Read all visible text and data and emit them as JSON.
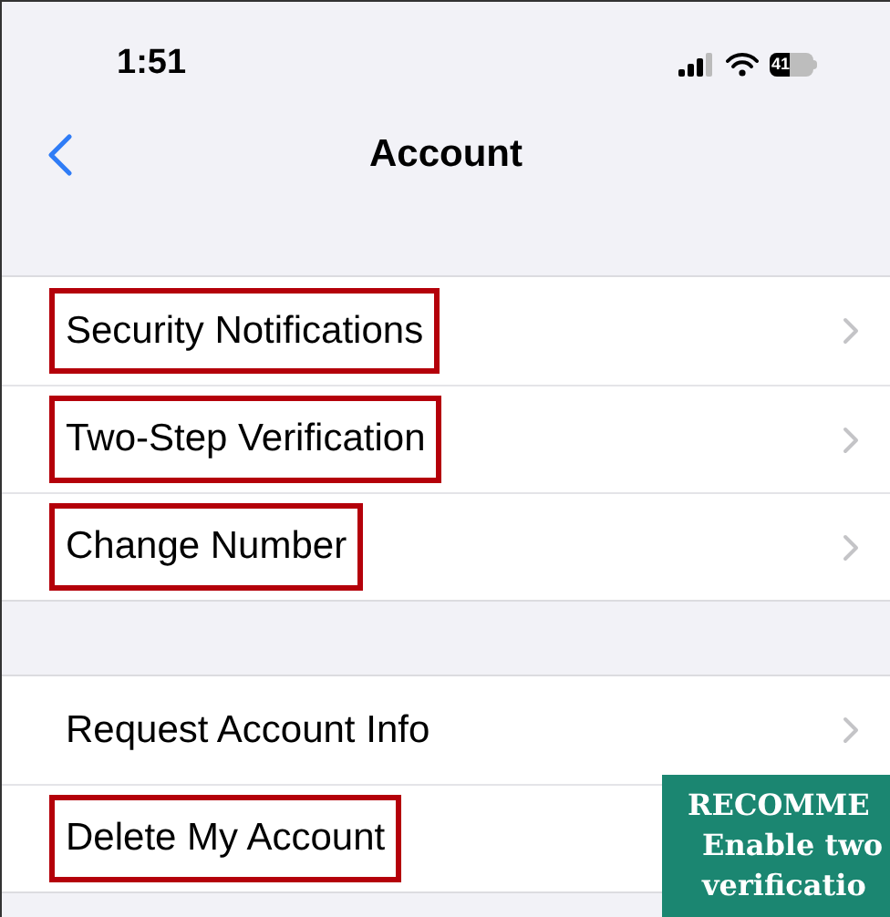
{
  "status_bar": {
    "time": "1:51",
    "battery": "41"
  },
  "nav": {
    "title": "Account"
  },
  "sections": [
    {
      "rows": [
        {
          "label": "Security Notifications",
          "highlighted": true
        },
        {
          "label": "Two-Step Verification",
          "highlighted": true
        },
        {
          "label": "Change Number",
          "highlighted": true
        }
      ]
    },
    {
      "rows": [
        {
          "label": "Request Account Info",
          "highlighted": false
        },
        {
          "label": "Delete My Account",
          "highlighted": true
        }
      ]
    }
  ],
  "callout": {
    "lines": [
      "RECOMME",
      "Enable two",
      "verificatio"
    ]
  }
}
